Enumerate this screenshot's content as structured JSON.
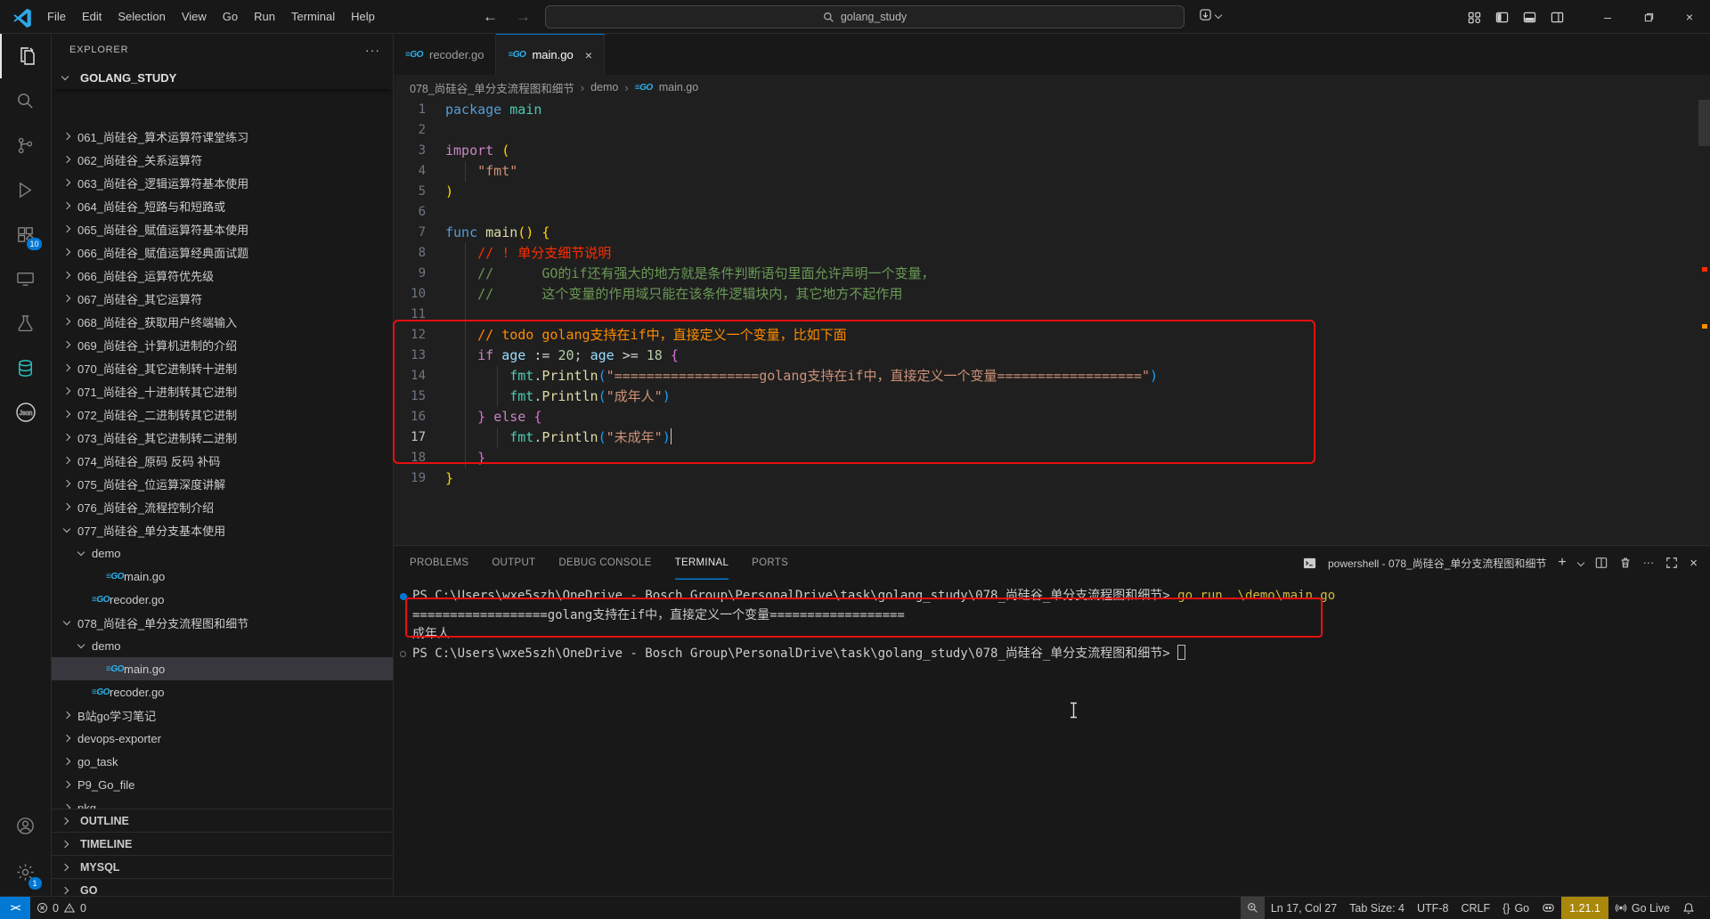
{
  "titlebar": {
    "menus": [
      "File",
      "Edit",
      "Selection",
      "View",
      "Go",
      "Run",
      "Terminal",
      "Help"
    ],
    "search_text": "golang_study",
    "window_controls": {
      "minimize": "–",
      "close": "×"
    }
  },
  "icons": {
    "more": "···",
    "back": "←",
    "forward": "→",
    "close": "×",
    "add": "+"
  },
  "activity_bar": {
    "items": [
      "explorer",
      "search",
      "source-control",
      "run-debug",
      "extensions",
      "remote-explorer",
      "testing",
      "database",
      "json"
    ],
    "extensions_badge": "10",
    "settings_badge": "1"
  },
  "explorer": {
    "title": "EXPLORER",
    "root": "GOLANG_STUDY",
    "items": [
      {
        "label": "061_尚硅谷_算术运算符课堂练习",
        "level": 1,
        "kind": "folder"
      },
      {
        "label": "062_尚硅谷_关系运算符",
        "level": 1,
        "kind": "folder"
      },
      {
        "label": "063_尚硅谷_逻辑运算符基本使用",
        "level": 1,
        "kind": "folder"
      },
      {
        "label": "064_尚硅谷_短路与和短路或",
        "level": 1,
        "kind": "folder"
      },
      {
        "label": "065_尚硅谷_赋值运算符基本使用",
        "level": 1,
        "kind": "folder"
      },
      {
        "label": "066_尚硅谷_赋值运算经典面试题",
        "level": 1,
        "kind": "folder"
      },
      {
        "label": "066_尚硅谷_运算符优先级",
        "level": 1,
        "kind": "folder"
      },
      {
        "label": "067_尚硅谷_其它运算符",
        "level": 1,
        "kind": "folder"
      },
      {
        "label": "068_尚硅谷_获取用户终端输入",
        "level": 1,
        "kind": "folder"
      },
      {
        "label": "069_尚硅谷_计算机进制的介绍",
        "level": 1,
        "kind": "folder"
      },
      {
        "label": "070_尚硅谷_其它进制转十进制",
        "level": 1,
        "kind": "folder"
      },
      {
        "label": "071_尚硅谷_十进制转其它进制",
        "level": 1,
        "kind": "folder"
      },
      {
        "label": "072_尚硅谷_二进制转其它进制",
        "level": 1,
        "kind": "folder"
      },
      {
        "label": "073_尚硅谷_其它进制转二进制",
        "level": 1,
        "kind": "folder"
      },
      {
        "label": "074_尚硅谷_原码 反码 补码",
        "level": 1,
        "kind": "folder"
      },
      {
        "label": "075_尚硅谷_位运算深度讲解",
        "level": 1,
        "kind": "folder"
      },
      {
        "label": "076_尚硅谷_流程控制介绍",
        "level": 1,
        "kind": "folder"
      },
      {
        "label": "077_尚硅谷_单分支基本使用",
        "level": 1,
        "kind": "folder",
        "expanded": true
      },
      {
        "label": "demo",
        "level": 2,
        "kind": "folder",
        "expanded": true
      },
      {
        "label": "main.go",
        "level": 3,
        "kind": "gofile"
      },
      {
        "label": "recoder.go",
        "level": 2,
        "kind": "gofile"
      },
      {
        "label": "078_尚硅谷_单分支流程图和细节",
        "level": 1,
        "kind": "folder",
        "expanded": true
      },
      {
        "label": "demo",
        "level": 2,
        "kind": "folder",
        "expanded": true
      },
      {
        "label": "main.go",
        "level": 3,
        "kind": "gofile",
        "selected": true
      },
      {
        "label": "recoder.go",
        "level": 2,
        "kind": "gofile"
      },
      {
        "label": "B站go学习笔记",
        "level": 1,
        "kind": "folder"
      },
      {
        "label": "devops-exporter",
        "level": 1,
        "kind": "folder"
      },
      {
        "label": "go_task",
        "level": 1,
        "kind": "folder"
      },
      {
        "label": "P9_Go_file",
        "level": 1,
        "kind": "folder"
      },
      {
        "label": "pkg",
        "level": 1,
        "kind": "folder"
      }
    ],
    "sections": [
      "OUTLINE",
      "TIMELINE",
      "MYSQL",
      "GO"
    ]
  },
  "tabs": [
    {
      "label": "recoder.go",
      "active": false
    },
    {
      "label": "main.go",
      "active": true
    }
  ],
  "breadcrumb": [
    "078_尚硅谷_单分支流程图和细节",
    "demo",
    "main.go"
  ],
  "editor": {
    "lines": [
      {
        "n": 1,
        "s": [
          [
            "kwb",
            "package"
          ],
          [
            "pl",
            " "
          ],
          [
            "typ",
            "main"
          ]
        ]
      },
      {
        "n": 2,
        "s": []
      },
      {
        "n": 3,
        "s": [
          [
            "kwp",
            "import"
          ],
          [
            "pl",
            " "
          ],
          [
            "b1",
            "("
          ]
        ]
      },
      {
        "n": 4,
        "s": [
          [
            "pl",
            "    "
          ],
          [
            "str",
            "\"fmt\""
          ]
        ]
      },
      {
        "n": 5,
        "s": [
          [
            "b1",
            ")"
          ]
        ]
      },
      {
        "n": 6,
        "s": []
      },
      {
        "n": 7,
        "s": [
          [
            "kwb",
            "func"
          ],
          [
            "pl",
            " "
          ],
          [
            "fn",
            "main"
          ],
          [
            "b1",
            "()"
          ],
          [
            "pl",
            " "
          ],
          [
            "b1",
            "{"
          ]
        ]
      },
      {
        "n": 8,
        "s": [
          [
            "pl",
            "    "
          ],
          [
            "cr",
            "// ! 单分支细节说明"
          ]
        ]
      },
      {
        "n": 9,
        "s": [
          [
            "pl",
            "    "
          ],
          [
            "cg",
            "//      GO的if还有强大的地方就是条件判断语句里面允许声明一个变量，"
          ]
        ]
      },
      {
        "n": 10,
        "s": [
          [
            "pl",
            "    "
          ],
          [
            "cg",
            "//      这个变量的作用域只能在该条件逻辑块内，其它地方不起作用"
          ]
        ]
      },
      {
        "n": 11,
        "s": []
      },
      {
        "n": 12,
        "s": [
          [
            "pl",
            "    "
          ],
          [
            "co",
            "// todo golang支持在if中，直接定义一个变量，比如下面"
          ]
        ]
      },
      {
        "n": 13,
        "s": [
          [
            "pl",
            "    "
          ],
          [
            "kwp",
            "if"
          ],
          [
            "pl",
            " "
          ],
          [
            "vr",
            "age"
          ],
          [
            "pl",
            " "
          ],
          [
            "op",
            ":="
          ],
          [
            "pl",
            " "
          ],
          [
            "num",
            "20"
          ],
          [
            "pl",
            "; "
          ],
          [
            "vr",
            "age"
          ],
          [
            "pl",
            " "
          ],
          [
            "op",
            ">="
          ],
          [
            "pl",
            " "
          ],
          [
            "num",
            "18"
          ],
          [
            "pl",
            " "
          ],
          [
            "b2",
            "{"
          ]
        ]
      },
      {
        "n": 14,
        "s": [
          [
            "pl",
            "        "
          ],
          [
            "typ",
            "fmt"
          ],
          [
            "pl",
            "."
          ],
          [
            "fn",
            "Println"
          ],
          [
            "b3",
            "("
          ],
          [
            "str",
            "\"==================golang支持在if中，直接定义一个变量==================\""
          ],
          [
            "b3",
            ")"
          ]
        ]
      },
      {
        "n": 15,
        "s": [
          [
            "pl",
            "        "
          ],
          [
            "typ",
            "fmt"
          ],
          [
            "pl",
            "."
          ],
          [
            "fn",
            "Println"
          ],
          [
            "b3",
            "("
          ],
          [
            "str",
            "\"成年人\""
          ],
          [
            "b3",
            ")"
          ]
        ]
      },
      {
        "n": 16,
        "s": [
          [
            "pl",
            "    "
          ],
          [
            "b2",
            "}"
          ],
          [
            "pl",
            " "
          ],
          [
            "kwp",
            "else"
          ],
          [
            "pl",
            " "
          ],
          [
            "b2",
            "{"
          ]
        ]
      },
      {
        "n": 17,
        "s": [
          [
            "pl",
            "        "
          ],
          [
            "typ",
            "fmt"
          ],
          [
            "pl",
            "."
          ],
          [
            "fn",
            "Println"
          ],
          [
            "b3",
            "("
          ],
          [
            "str",
            "\"未成年\""
          ],
          [
            "b3",
            ")"
          ],
          [
            "cur",
            ""
          ]
        ],
        "active": true
      },
      {
        "n": 18,
        "s": [
          [
            "pl",
            "    "
          ],
          [
            "b2",
            "}"
          ]
        ]
      },
      {
        "n": 19,
        "s": [
          [
            "b1",
            "}"
          ]
        ]
      }
    ]
  },
  "panel": {
    "tabs": [
      "PROBLEMS",
      "OUTPUT",
      "DEBUG CONSOLE",
      "TERMINAL",
      "PORTS"
    ],
    "active_tab": "TERMINAL",
    "shell_label": "powershell - 078_尚硅谷_单分支流程图和细节",
    "terminal_lines": [
      {
        "deco": "blue",
        "s": [
          [
            "pr",
            "PS C:\\Users\\wxe5szh\\OneDrive - Bosch Group\\PersonalDrive\\task\\golang_study\\078_尚硅谷_单分支流程图和细节> "
          ],
          [
            "cmd",
            "go run .\\demo\\main.go"
          ]
        ]
      },
      {
        "s": [
          [
            "out",
            "==================golang支持在if中，直接定义一个变量=================="
          ]
        ]
      },
      {
        "s": [
          [
            "out",
            "成年人"
          ]
        ]
      },
      {
        "deco": "hollow",
        "s": [
          [
            "pr",
            "PS C:\\Users\\wxe5szh\\OneDrive - Bosch Group\\PersonalDrive\\task\\golang_study\\078_尚硅谷_单分支流程图和细节> "
          ],
          [
            "curbox",
            ""
          ]
        ]
      }
    ]
  },
  "status_bar": {
    "remote_glyph": "><",
    "errors": "0",
    "warnings": "0",
    "line_col": "Ln 17, Col 27",
    "tab_size": "Tab Size: 4",
    "encoding": "UTF-8",
    "eol": "CRLF",
    "braces_glyph": "{}",
    "language": "Go",
    "go_version": "1.21.1",
    "go_live": "Go Live"
  },
  "colors": {
    "accent": "#0078d4",
    "editor_bg": "#1f1f1f",
    "side_bg": "#181818",
    "annotation_red": "#e90f0f",
    "gold_badge": "#a8870a"
  }
}
